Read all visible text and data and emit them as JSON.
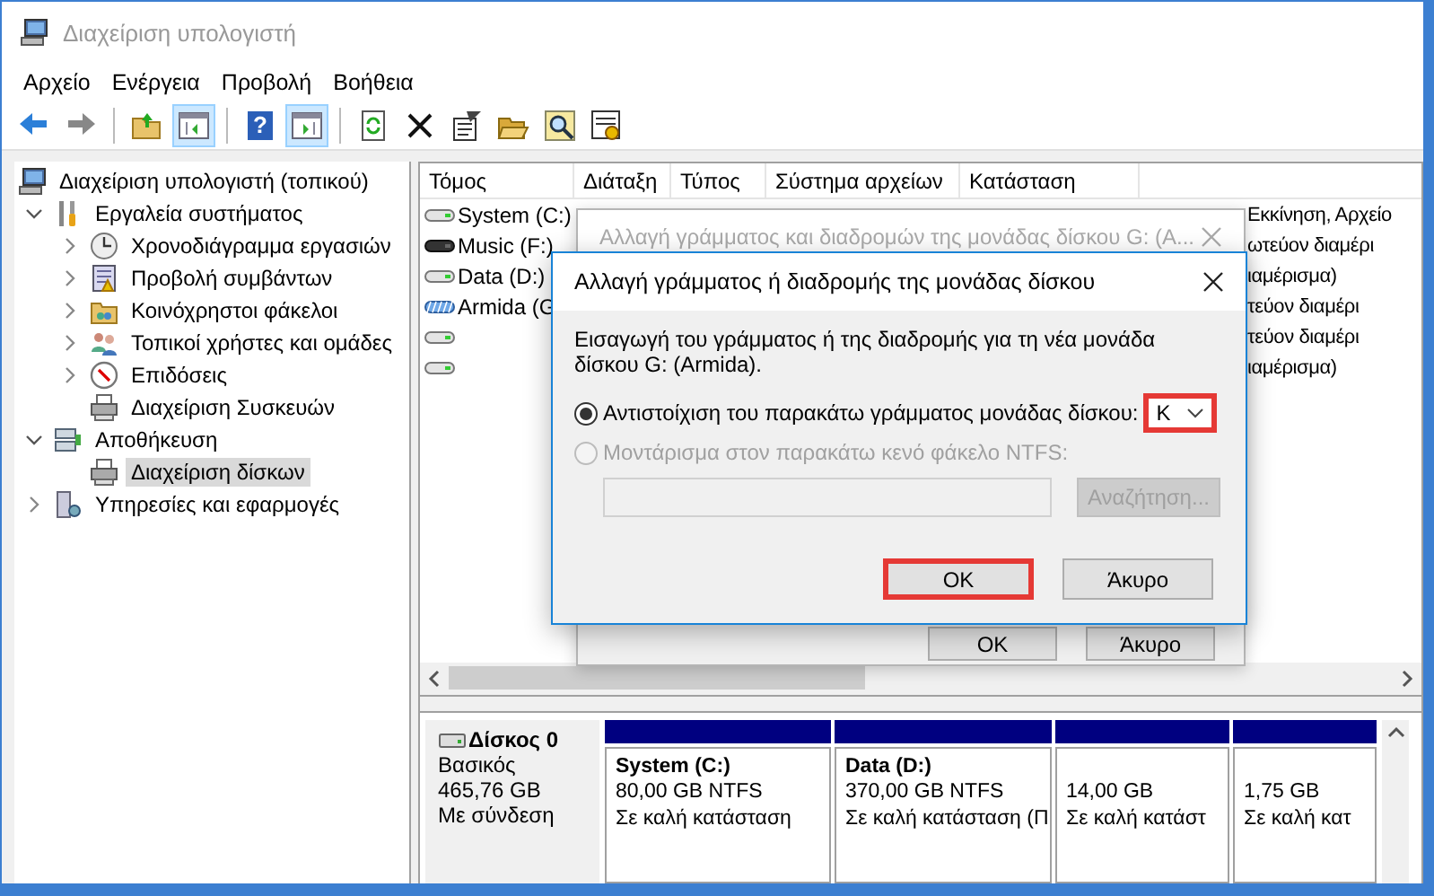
{
  "window": {
    "title": "Διαχείριση υπολογιστή"
  },
  "menu": [
    "Αρχείο",
    "Ενέργεια",
    "Προβολή",
    "Βοήθεια"
  ],
  "toolbar": [
    {
      "on": false
    },
    {
      "on": false
    },
    {
      "on": false
    },
    {
      "on": true
    },
    {
      "on": false,
      "glyph": "?"
    },
    {
      "on": true
    },
    {
      "on": false
    },
    {
      "on": false
    },
    {
      "on": false
    },
    {
      "on": false
    },
    {
      "on": false
    },
    {
      "on": false
    }
  ],
  "tree": [
    {
      "label": "Διαχείριση υπολογιστή (τοπικού)",
      "kind": "computer",
      "selected": false,
      "children": [
        {
          "label": "Εργαλεία συστήματος",
          "kind": "tools",
          "expanded": true,
          "selected": false,
          "children": [
            {
              "label": "Χρονοδιάγραμμα εργασιών",
              "kind": "clock",
              "expanded": false,
              "selected": false
            },
            {
              "label": "Προβολή συμβάντων",
              "kind": "event",
              "expanded": false,
              "selected": false
            },
            {
              "label": "Κοινόχρηστοι φάκελοι",
              "kind": "share",
              "expanded": false,
              "selected": false
            },
            {
              "label": "Τοπικοί χρήστες και ομάδες",
              "kind": "users",
              "expanded": false,
              "selected": false
            },
            {
              "label": "Επιδόσεις",
              "kind": "perf",
              "expanded": false,
              "selected": false
            },
            {
              "label": "Διαχείριση Συσκευών",
              "kind": "device",
              "selected": false
            }
          ]
        },
        {
          "label": "Αποθήκευση",
          "kind": "storage",
          "expanded": true,
          "selected": false,
          "children": [
            {
              "label": "Διαχείριση δίσκων",
              "kind": "device",
              "selected": true
            }
          ]
        },
        {
          "label": "Υπηρεσίες και εφαρμογές",
          "kind": "services",
          "expanded": false,
          "selected": false
        }
      ]
    }
  ],
  "volumes": {
    "columns": [
      "Τόμος",
      "Διάταξη",
      "Τύπος",
      "Σύστημα αρχείων",
      "Κατάσταση"
    ],
    "rows": [
      {
        "kind": "plain",
        "name": "System (C:)",
        "status": "Εκκίνηση, Αρχείο"
      },
      {
        "kind": "dark",
        "name": "Music (F:)",
        "status": "ωτεύον διαμέρι"
      },
      {
        "kind": "plain",
        "name": "Data (D:)",
        "status": "ιαμέρισμα)"
      },
      {
        "kind": "striped",
        "name": "Armida (G",
        "status": "τεύον διαμέρι"
      },
      {
        "kind": "plain",
        "status": "τεύον διαμέρι"
      },
      {
        "kind": "plain",
        "status": "ιαμέρισμα)"
      }
    ]
  },
  "back_dialog": {
    "title": "Αλλαγή γράμματος και διαδρομών της μονάδας δίσκου G: (A...",
    "buttons": [
      "OK",
      "Άκυρο"
    ]
  },
  "dialog": {
    "title": "Αλλαγή γράμματος ή διαδρομής της μονάδας δίσκου",
    "prompt": "Εισαγωγή του γράμματος ή της διαδρομής για τη νέα μονάδα δίσκου G: (Armida).",
    "options": [
      {
        "label": "Αντιστοίχιση του παρακάτω γράμματος μονάδας δίσκου:",
        "selected": true,
        "disabled": false
      },
      {
        "label": "Μοντάρισμα στον παρακάτω κενό φάκελο NTFS:",
        "selected": false,
        "disabled": true
      }
    ],
    "letter": {
      "value": "K",
      "highlighted": true
    },
    "folder": {
      "disabled": true
    },
    "browse": {
      "label": "Αναζήτηση...",
      "disabled": true
    },
    "buttons": [
      {
        "label": "OK",
        "highlighted": true
      },
      {
        "label": "Άκυρο",
        "highlighted": false
      }
    ]
  },
  "disk": {
    "name": "Δίσκος 0",
    "type": "Βασικός",
    "size": "465,76 GB",
    "state": "Με σύνδεση",
    "partitions": [
      {
        "name": "System  (C:)",
        "size": "80,00 GB NTFS",
        "status": "Σε καλή κατάσταση"
      },
      {
        "name": "Data  (D:)",
        "size": "370,00 GB NTFS",
        "status": "Σε καλή κατάσταση (Π"
      },
      {
        "size": "14,00 GB",
        "status": "Σε καλή κατάστ"
      },
      {
        "size": "1,75 GB",
        "status": "Σε καλή κατ"
      }
    ]
  }
}
